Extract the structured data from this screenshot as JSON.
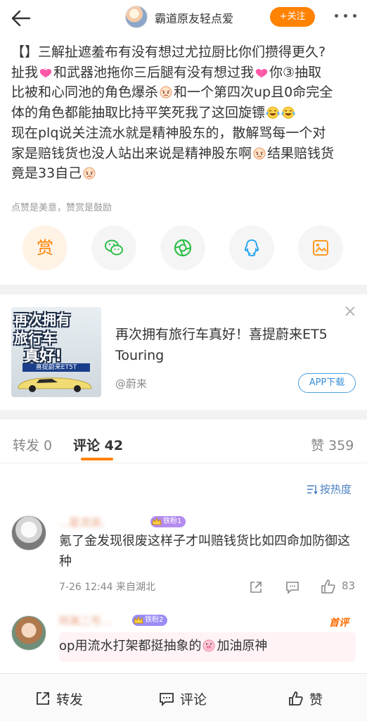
{
  "header": {
    "user_name": "霸道原友轻点爱",
    "follow_label": "+关注"
  },
  "post": {
    "line1": "【】三解扯遮羞布有没有想过尤拉厨比你们攒得更久?",
    "line2a": "扯我",
    "line2b": "和武器池拖你三后腿有没有想过我",
    "line2c": "你③抽取",
    "line3a": "比被和心同池的角色爆杀",
    "line3b": "和一个第四次up且0命完全",
    "line4a": "体的角色都能抽取比持平笑死我了这回旋镖",
    "line5": "现在plq说关注流水就是精神股东的，散解骂每一个对",
    "line6a": "家是赔钱货也没人站出来说是精神股东啊",
    "line6b": "结果赔钱货",
    "line7a": "竟是33自己"
  },
  "reward_hint": "点赞是美意，赞赏是鼓励",
  "share": {
    "reward_label": "赏"
  },
  "ad": {
    "thumb_line1": "再次拥有",
    "thumb_line2": "旅行车",
    "thumb_line3": "真好!",
    "thumb_line4": "喜提蔚来ET5T",
    "title": "再次拥有旅行车真好！喜提蔚来ET5 Touring",
    "source": "@蔚来",
    "app_label": "APP下载"
  },
  "tabs": {
    "repost": "转发 0",
    "comment": "评论 42",
    "like": "赞 359"
  },
  "sort_label": "按热度",
  "comments": [
    {
      "name": "...星流浪、",
      "badge": "铁粉1",
      "text": "氪了金发现很废这样子才叫赔钱货比如四命加防御这种",
      "time": "7-26 12:44",
      "location": "来自湖北",
      "likes": "83"
    },
    {
      "name": "阿离二号...",
      "badge": "铁粉2",
      "hot_tag": "首评",
      "text_a": "op用流水打架都挺抽象的",
      "text_b": "加油原神"
    }
  ],
  "bottom_bar": {
    "repost": "转发",
    "comment": "评论",
    "like": "赞"
  },
  "colors": {
    "accent": "#ff8200",
    "link_blue": "#4a7fc1"
  },
  "icons": [
    "back-arrow-icon",
    "more-icon",
    "heart-emoji",
    "angry-emoji",
    "laugh-cry-emoji",
    "wechat-icon",
    "moments-icon",
    "qq-icon",
    "save-image-icon",
    "close-icon",
    "sort-icon",
    "share-icon",
    "reply-icon",
    "thumb-up-icon",
    "comment-icon",
    "crown-icon"
  ]
}
